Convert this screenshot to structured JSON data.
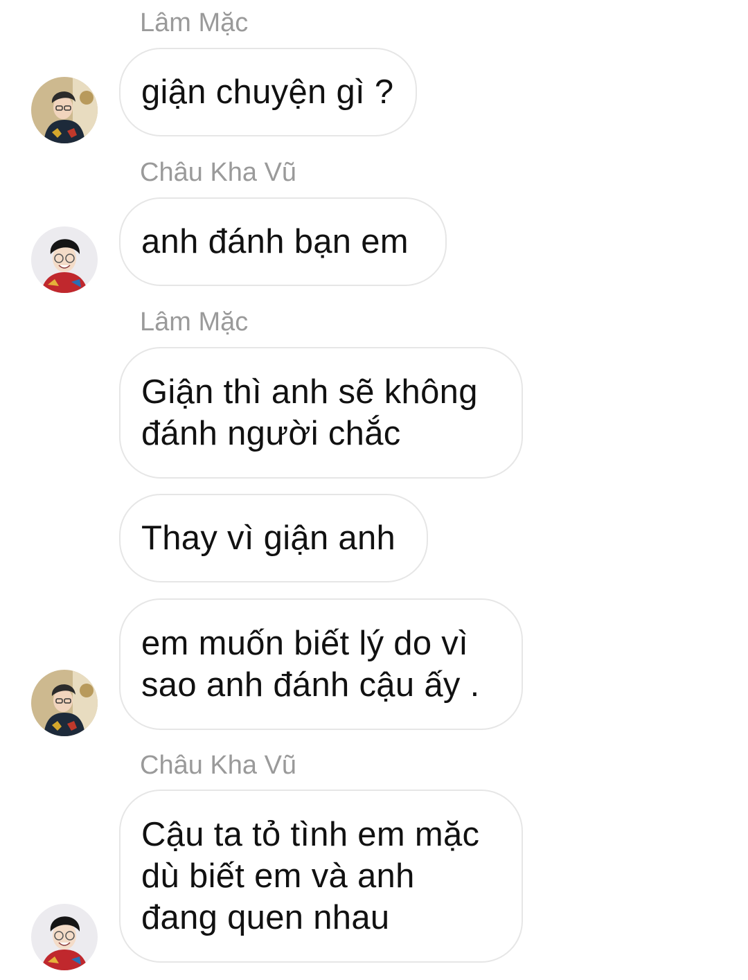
{
  "messages": [
    {
      "sender": "Lâm Mặc",
      "text": "giận chuyện gì ?"
    },
    {
      "sender": "Châu Kha Vũ",
      "text": "anh đánh bạn em"
    },
    {
      "sender": "Lâm Mặc",
      "text": "Giận thì anh sẽ không\nđánh người chắc"
    },
    {
      "text": "Thay vì giận anh"
    },
    {
      "text": "em muốn biết lý do vì\nsao anh đánh cậu ấy ."
    },
    {
      "sender": "Châu Kha Vũ",
      "text": "Cậu ta tỏ tình em mặc\ndù biết em và anh\nđang quen nhau"
    }
  ],
  "avatars": {
    "lam_mac": {
      "icon": "avatar-lam-mac-photo",
      "bg": "#c9b48a"
    },
    "chau_kha_vu": {
      "icon": "avatar-chau-kha-vu-photo",
      "bg": "#e9e9ec"
    }
  }
}
